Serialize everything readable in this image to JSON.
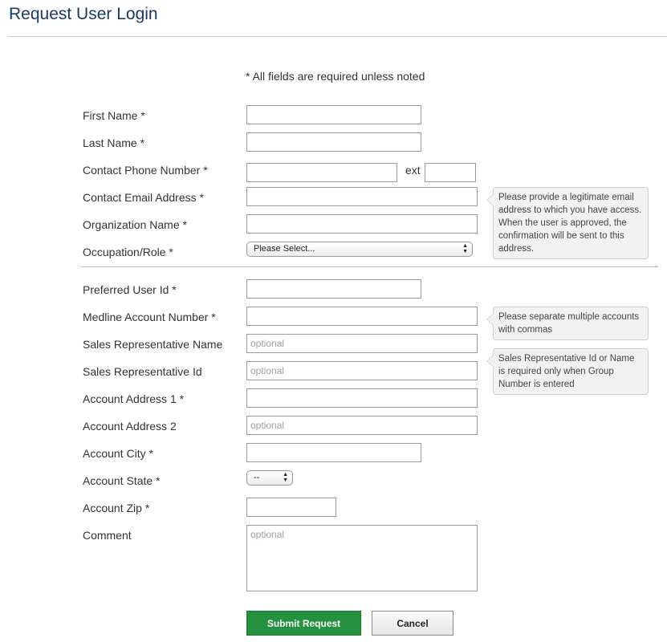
{
  "page": {
    "title": "Request User Login",
    "required_note": "* All fields are required unless noted"
  },
  "form": {
    "first_name": {
      "label": "First Name *",
      "value": ""
    },
    "last_name": {
      "label": "Last Name *",
      "value": ""
    },
    "phone": {
      "label": "Contact Phone Number *",
      "value": "",
      "ext_label": "ext",
      "ext_value": ""
    },
    "email": {
      "label": "Contact Email Address *",
      "value": ""
    },
    "organization": {
      "label": "Organization Name *",
      "value": ""
    },
    "occupation": {
      "label": "Occupation/Role *",
      "selected": "Please Select..."
    },
    "user_id": {
      "label": "Preferred User Id *",
      "value": ""
    },
    "medline_account": {
      "label": "Medline Account Number *",
      "value": ""
    },
    "sales_rep_name": {
      "label": "Sales Representative Name",
      "placeholder": "optional"
    },
    "sales_rep_id": {
      "label": "Sales Representative Id",
      "placeholder": "optional"
    },
    "address1": {
      "label": "Account Address 1 *",
      "value": ""
    },
    "address2": {
      "label": "Account Address 2",
      "placeholder": "optional"
    },
    "city": {
      "label": "Account City *",
      "value": ""
    },
    "state": {
      "label": "Account State *",
      "selected": "--"
    },
    "zip": {
      "label": "Account Zip *",
      "value": ""
    },
    "comment": {
      "label": "Comment",
      "placeholder": "optional"
    }
  },
  "tooltips": {
    "email": "Please provide a legitimate email address to which you have access. When the user is approved, the confirmation will be sent to this address.",
    "accounts": "Please separate multiple accounts with commas",
    "sales_rep": "Sales Representative Id or Name is required only when Group Number is entered"
  },
  "buttons": {
    "submit": "Submit Request",
    "cancel": "Cancel"
  },
  "colors": {
    "title": "#1a3a66",
    "submit_bg": "#23913f"
  },
  "icons": {
    "select_arrows": "up-down-chevron-icon"
  }
}
